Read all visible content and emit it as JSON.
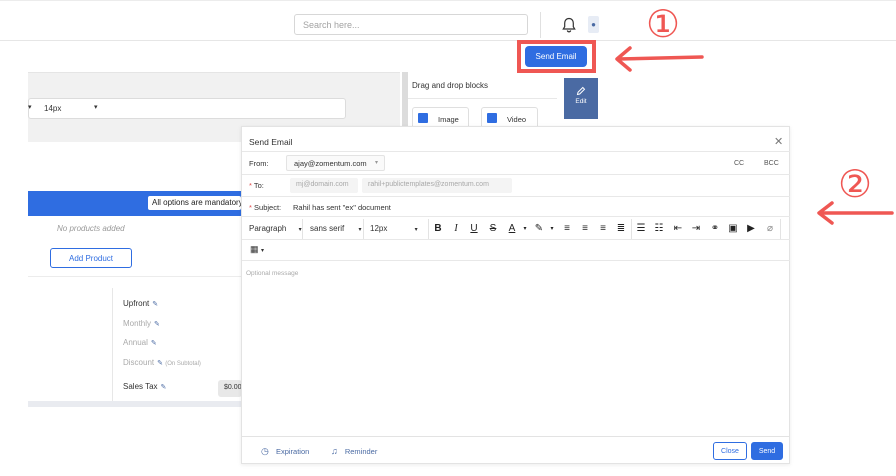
{
  "topbar": {
    "search_placeholder": "Search here..."
  },
  "header": {
    "send_email_label": "Send Email"
  },
  "annotations": {
    "step1": "①",
    "step2": "②",
    "color": "#ef5753"
  },
  "editor": {
    "font_size": "14px",
    "blocks_title": "Drag and drop blocks",
    "blocks": [
      "Image",
      "Video"
    ],
    "edit_label": "Edit"
  },
  "quote": {
    "options_notice": "All options are mandatory",
    "no_products": "No products added",
    "add_product_label": "Add Product",
    "totals": {
      "upfront": "Upfront",
      "monthly": "Monthly",
      "annual": "Annual",
      "discount": "Discount",
      "discount_note": "(On Subtotal)",
      "sales_tax": "Sales Tax",
      "sales_tax_value": "$0.00"
    }
  },
  "modal": {
    "title": "Send Email",
    "from_label": "From:",
    "from_value": "ajay@zomentum.com",
    "to_label": "To:",
    "to_chips": [
      "mj@domain.com",
      "rahil+publictemplates@zomentum.com"
    ],
    "cc_label": "CC",
    "bcc_label": "BCC",
    "subject_label": "Subject:",
    "subject_value": "Rahil has sent \"ex\" document",
    "toolbar": {
      "block_format": "Paragraph",
      "font_family": "sans serif",
      "font_size": "12px"
    },
    "message_placeholder": "Optional message",
    "footer": {
      "expiration_label": "Expiration",
      "reminder_label": "Reminder",
      "close_label": "Close",
      "send_label": "Send"
    }
  },
  "colors": {
    "primary": "#2f6de1",
    "annotation": "#ef5753",
    "nav_accent": "#4a6aa3"
  }
}
